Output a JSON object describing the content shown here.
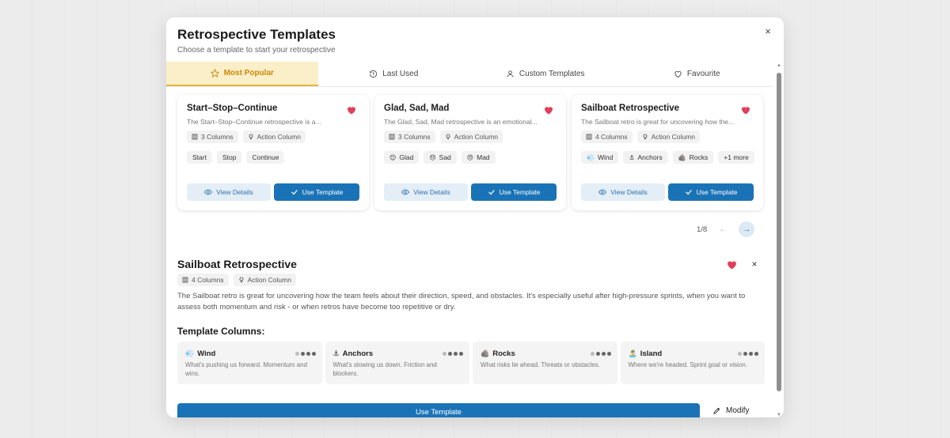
{
  "modal": {
    "title": "Retrospective Templates",
    "subtitle": "Choose a template to start your retrospective",
    "close": "×"
  },
  "tabs": [
    {
      "label": "Most Popular",
      "icon": "star-icon",
      "active": true
    },
    {
      "label": "Last Used",
      "icon": "history-icon",
      "active": false
    },
    {
      "label": "Custom Templates",
      "icon": "user-icon",
      "active": false
    },
    {
      "label": "Favourite",
      "icon": "heart-outline-icon",
      "active": false
    }
  ],
  "cards": [
    {
      "title": "Start–Stop–Continue",
      "desc": "The Start–Stop–Continue retrospective is a...",
      "columns_meta": "3 Columns",
      "action_meta": "Action Column",
      "columns": [
        {
          "emoji": "",
          "label": "Start"
        },
        {
          "emoji": "",
          "label": "Stop"
        },
        {
          "emoji": "",
          "label": "Continue"
        }
      ],
      "view_label": "View Details",
      "use_label": "Use Template"
    },
    {
      "title": "Glad, Sad, Mad",
      "desc": "The Glad, Sad, Mad retrospective is an emotional...",
      "columns_meta": "3 Columns",
      "action_meta": "Action Column",
      "columns": [
        {
          "emoji": "😊",
          "label": "Glad"
        },
        {
          "emoji": "😞",
          "label": "Sad"
        },
        {
          "emoji": "😠",
          "label": "Mad"
        }
      ],
      "view_label": "View Details",
      "use_label": "Use Template"
    },
    {
      "title": "Sailboat Retrospective",
      "desc": "The Sailboat retro is great for uncovering how the...",
      "columns_meta": "4 Columns",
      "action_meta": "Action Column",
      "columns": [
        {
          "emoji": "💨",
          "label": "Wind"
        },
        {
          "emoji": "⚓",
          "label": "Anchors"
        },
        {
          "emoji": "🪨",
          "label": "Rocks"
        }
      ],
      "more_label": "+1 more",
      "view_label": "View Details",
      "use_label": "Use Template"
    }
  ],
  "pager": {
    "text": "1/8",
    "prev": "←",
    "next": "→"
  },
  "detail": {
    "title": "Sailboat Retrospective",
    "columns_meta": "4 Columns",
    "action_meta": "Action Column",
    "desc": "The Sailboat retro is great for uncovering how the team feels about their direction, speed, and obstacles. It's especially useful after high-pressure sprints, when you want to assess both momentum and risk - or when retros have become too repetitive or dry.",
    "section_title": "Template Columns:",
    "close": "×",
    "columns": [
      {
        "emoji": "💨",
        "name": "Wind",
        "desc": "What's pushing us forward. Momentum and wins."
      },
      {
        "emoji": "⚓",
        "name": "Anchors",
        "desc": "What's slowing us down. Friction and blockers."
      },
      {
        "emoji": "🪨",
        "name": "Rocks",
        "desc": "What risks lie ahead. Threats or obstacles."
      },
      {
        "emoji": "🏝️",
        "name": "Island",
        "desc": "Where we're headed. Sprint goal or vision."
      }
    ]
  },
  "footer": {
    "use_label": "Use Template",
    "modify_label": "Modify"
  },
  "colors": {
    "accent": "#1a73b6",
    "tab_active_bg": "#fbefc9",
    "tab_active_text": "#c98a08",
    "heart": "#e0405a"
  }
}
